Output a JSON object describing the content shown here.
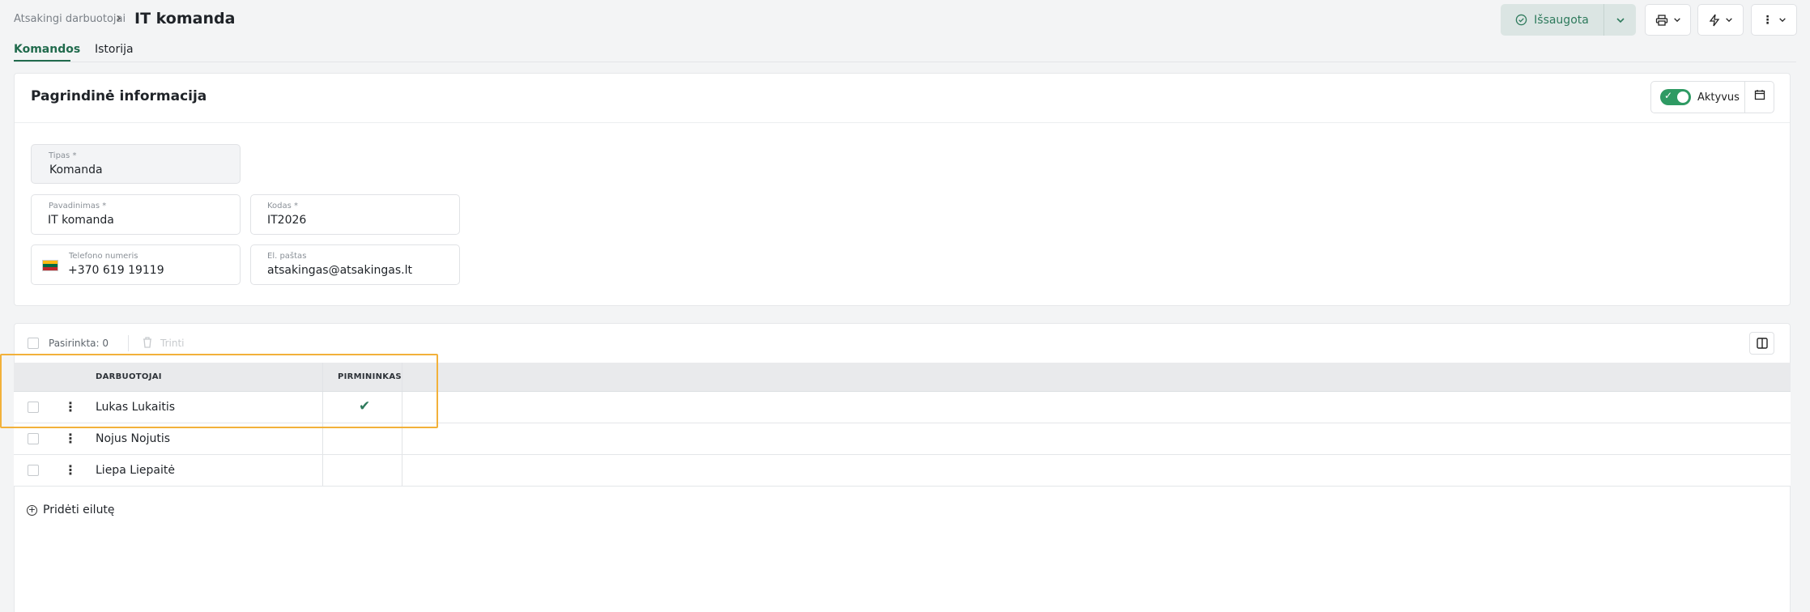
{
  "header": {
    "breadcrumb": "Atsakingi darbuotojai",
    "title": "IT komanda",
    "save_label": "Išsaugota"
  },
  "tabs": [
    {
      "label": "Komandos",
      "active": true
    },
    {
      "label": "Istorija",
      "active": false
    }
  ],
  "basic_info": {
    "title": "Pagrindinė informacija",
    "active_label": "Aktyvus",
    "fields": {
      "type": {
        "label": "Tipas *",
        "value": "Komanda"
      },
      "name": {
        "label": "Pavadinimas *",
        "value": "IT komanda"
      },
      "code": {
        "label": "Kodas *",
        "value": "IT2026"
      },
      "phone": {
        "label": "Telefono numeris",
        "value": "+370 619 19119"
      },
      "email": {
        "label": "El. paštas",
        "value": "atsakingas@atsakingas.lt"
      }
    }
  },
  "table": {
    "selected_label": "Pasirinkta: 0",
    "delete_label": "Trinti",
    "columns": [
      "DARBUOTOJAI",
      "PIRMININKAS"
    ],
    "rows": [
      {
        "name": "Lukas Lukaitis",
        "chairman": true
      },
      {
        "name": "Nojus Nojutis",
        "chairman": false
      },
      {
        "name": "Liepa Liepaitė",
        "chairman": false
      }
    ],
    "add_row_label": "Pridėti eilutę"
  },
  "colors": {
    "accent": "#216b4d",
    "highlight": "#f2b13a"
  }
}
